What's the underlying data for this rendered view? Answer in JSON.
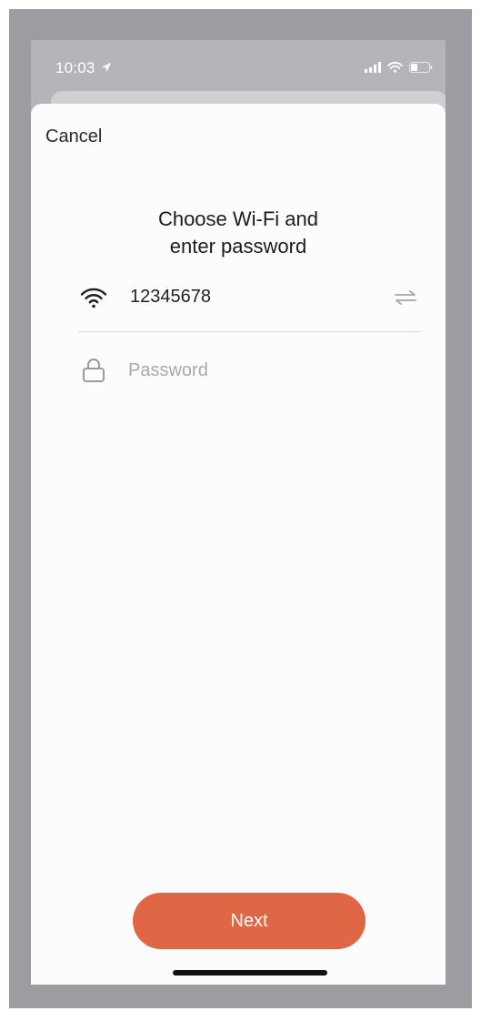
{
  "status_bar": {
    "time": "10:03",
    "location_icon": "location-arrow-icon",
    "signal_icon": "cellular-signal-icon",
    "wifi_icon": "wifi-status-icon",
    "battery_icon": "battery-icon"
  },
  "sheet": {
    "cancel_label": "Cancel",
    "title_line1": "Choose Wi-Fi and",
    "title_line2": "enter password"
  },
  "wifi_row": {
    "icon": "wifi-icon",
    "ssid": "12345678",
    "switch_icon": "switch-network-icon"
  },
  "password_row": {
    "icon": "lock-icon",
    "value": "",
    "placeholder": "Password"
  },
  "next_button": {
    "label": "Next"
  },
  "colors": {
    "accent": "#e06746",
    "sheet_bg": "#fcfcfc",
    "frame_bg": "#9c9da1"
  }
}
